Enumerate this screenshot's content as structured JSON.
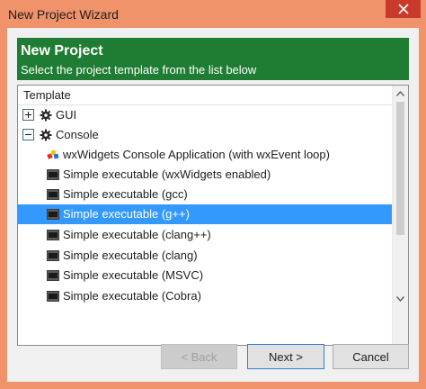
{
  "window": {
    "title": "New Project Wizard"
  },
  "banner": {
    "title": "New Project",
    "subtitle": "Select the project template from the list below"
  },
  "tree": {
    "header": "Template",
    "items": [
      {
        "label": "GUI",
        "kind": "category",
        "expanded": false,
        "icon": "gear-icon"
      },
      {
        "label": "Console",
        "kind": "category",
        "expanded": true,
        "icon": "gear-icon"
      },
      {
        "label": "wxWidgets Console Application (with wxEvent loop)",
        "kind": "template",
        "icon": "wxwidgets-icon"
      },
      {
        "label": "Simple executable (wxWidgets enabled)",
        "kind": "template",
        "icon": "executable-icon"
      },
      {
        "label": "Simple executable (gcc)",
        "kind": "template",
        "icon": "executable-icon"
      },
      {
        "label": "Simple executable (g++)",
        "kind": "template",
        "icon": "executable-icon",
        "selected": true
      },
      {
        "label": "Simple executable (clang++)",
        "kind": "template",
        "icon": "executable-icon"
      },
      {
        "label": "Simple executable (clang)",
        "kind": "template",
        "icon": "executable-icon"
      },
      {
        "label": "Simple executable (MSVC)",
        "kind": "template",
        "icon": "executable-icon"
      },
      {
        "label": "Simple executable (Cobra)",
        "kind": "template",
        "icon": "executable-icon"
      }
    ]
  },
  "buttons": {
    "back": "< Back",
    "next": "Next >",
    "cancel": "Cancel"
  },
  "colors": {
    "titlebar": "#f0926a",
    "banner": "#1e7d32",
    "selection": "#3399ff",
    "close_button": "#c83a2c"
  }
}
